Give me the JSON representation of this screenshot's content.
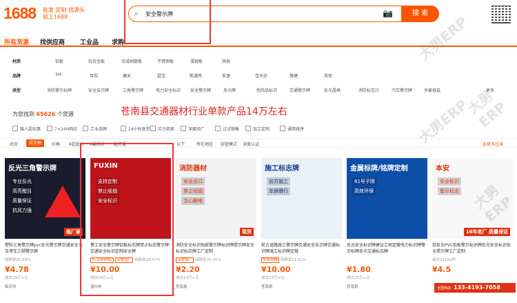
{
  "header": {
    "logo": "1688",
    "slogan_top": "批发 定制 找源头",
    "slogan_bottom": "就上1688",
    "search_value": "安全警示牌",
    "search_button": "搜 索"
  },
  "nav": [
    "所有货源",
    "找供应商",
    "工业品",
    "求购"
  ],
  "filters": [
    {
      "label": "材质",
      "values": [
        "铝板",
        "铝合金板",
        "合成树脂板",
        "不锈钢板",
        "薄钢板",
        "其他"
      ]
    },
    {
      "label": "品牌",
      "values": [
        "3M",
        "目视",
        "康关",
        "超宝",
        "新通亮",
        "采源",
        "佳天达",
        "路捷",
        "其他"
      ]
    },
    {
      "label": "类型",
      "values": [
        "消防警示标牌",
        "安全告示牌",
        "三角警示牌",
        "电力安全标识",
        "安全警示牌",
        "反光牌",
        "危险品标识",
        "交通警示牌",
        "反光晶格",
        "消防标志灯",
        "汽车警示牌",
        "多套挑选"
      ],
      "more": "更多"
    }
  ],
  "results": {
    "prefix": "为您找到",
    "count": "65626",
    "suffix": "个货源"
  },
  "overlay_text": "苍南县交通器材行业单款产品14万左右",
  "checks": [
    "猫人超优惠",
    "7×24H响应",
    "工业品牌",
    "24小时发货",
    "实力商家",
    "深度验厂",
    "过试销售",
    "加工定制",
    "通用排序"
  ],
  "sort": {
    "items": [
      "综合",
      "成交额",
      "价格",
      "¥起批价",
      "¥最高价",
      "起订量",
      "以下",
      "所在地区",
      "轻管模式",
      "深度认证"
    ],
    "active": "成交额",
    "right": "选择多区域"
  },
  "products": [
    {
      "banner": "反光三角警示牌",
      "lines": [
        "专业反光",
        "高亮醒目",
        "质量保证",
        "抗风力强"
      ],
      "badge": "临厂家",
      "title": "塑料三角警示牌pvc反光警示牌交通安全汽车停车三脚警示牌",
      "tags": [],
      "extra": "回购率20.69%",
      "price": "¥4.78",
      "sold": "成交29万+元",
      "shop": "临沂市"
    },
    {
      "banner": "FUXIN",
      "lines": [
        "支持定制",
        "禁止吸烟",
        "安全标识"
      ],
      "badge": "",
      "title": "警工安全警示牌铝板标志牌禁止标志警示牌交通安全标识定制安全牌",
      "tags": [
        "7×24H响应",
        "深度验厂"
      ],
      "extra": "回购率28.57%",
      "price": "¥10.00",
      "sold": "成交14万+元",
      "shop": "温州市"
    },
    {
      "banner": "消防器材",
      "lines": [
        "安全出口",
        "禁止吸烟",
        "当心触电"
      ],
      "badge": "现货",
      "title": "消防安全标识贴纸警示牌标识牌提示牌安全标识标志牌工厂定制",
      "tags": [
        "深度验厂"
      ],
      "extra": "回购率30.76%",
      "price": "¥2.20",
      "sold": "成交13万+元",
      "shop": "苍南县"
    },
    {
      "banner": "施工标志牌",
      "lines": [
        "前方施工",
        "车辆慢行"
      ],
      "badge": "",
      "title": "前方道路施工警示牌交通安全告示牌交通标识牌施工标识牌定做",
      "tags": [
        "免费拼模"
      ],
      "extra": "回购率31.82%",
      "price": "¥10.00",
      "sold": "成交13万+元",
      "shop": "苍南县"
    },
    {
      "banner": "金属标牌/铭牌定制",
      "lines": [
        "61号子牌",
        "高效环保"
      ],
      "badge": "",
      "title": "反光安全标识牌建议工地定做电力标识牌警示标牌反光交通标志牌",
      "tags": [],
      "extra": "",
      "price": "¥1.80",
      "sold": "成交15万+元",
      "shop": "苍南县"
    },
    {
      "banner": "本安",
      "lines": [
        "安全标识",
        "警示标志"
      ],
      "badge": "16年老厂 质量保证",
      "title": "铝反光PVC铝板警示标识牌反光安全标识安全提示牌工厂定制",
      "tags": [],
      "extra": "成交93162件",
      "price": "¥4.5",
      "sold": "",
      "shop": ""
    }
  ],
  "hotline": {
    "label": "全国热线",
    "number": "133-4193-7058"
  },
  "watermark": "大男ERP",
  "colors": {
    "brand": "#ff5500",
    "highlight": "#e33333"
  }
}
